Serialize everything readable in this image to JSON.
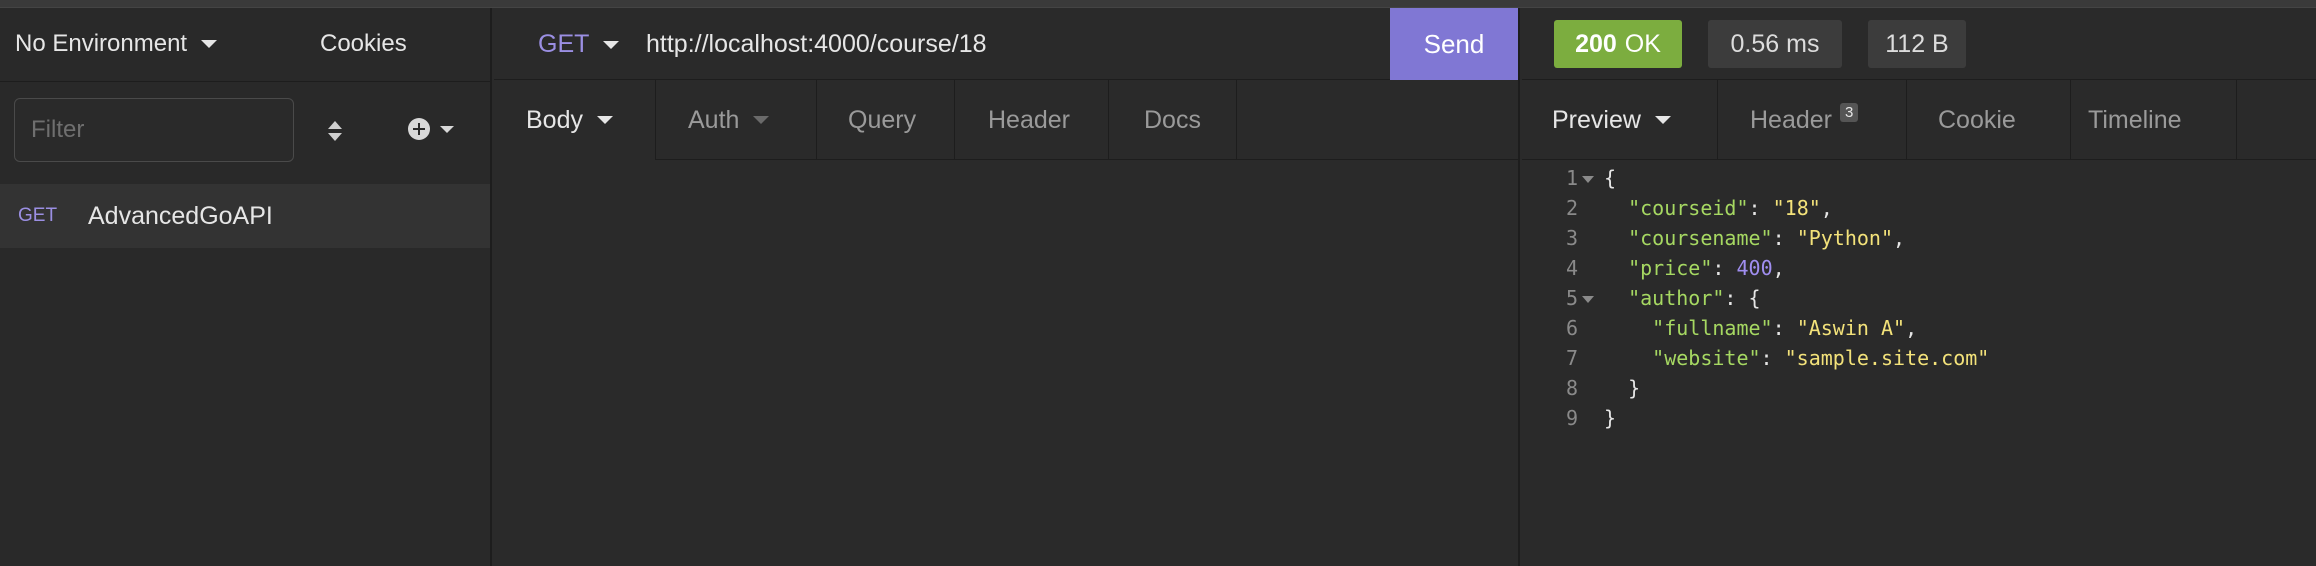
{
  "sidebar": {
    "environment": "No Environment",
    "cookies_label": "Cookies",
    "filter_placeholder": "Filter",
    "requests": [
      {
        "method": "GET",
        "name": "AdvancedGoAPI"
      }
    ]
  },
  "request": {
    "method": "GET",
    "url": "http://localhost:4000/course/18",
    "send_label": "Send",
    "tabs": [
      "Body",
      "Auth",
      "Query",
      "Header",
      "Docs"
    ]
  },
  "response": {
    "status_code": "200",
    "status_text": "OK",
    "time": "0.56 ms",
    "size": "112 B",
    "tabs": [
      "Preview",
      "Header",
      "Cookie",
      "Timeline"
    ],
    "header_count": "3",
    "body_lines": [
      {
        "n": "1",
        "parts": [
          [
            "p",
            "{"
          ]
        ]
      },
      {
        "n": "2",
        "parts": [
          [
            "p",
            "  "
          ],
          [
            "k",
            "\"courseid\""
          ],
          [
            "p",
            ": "
          ],
          [
            "s",
            "\"18\""
          ],
          [
            "p",
            ","
          ]
        ]
      },
      {
        "n": "3",
        "parts": [
          [
            "p",
            "  "
          ],
          [
            "k",
            "\"coursename\""
          ],
          [
            "p",
            ": "
          ],
          [
            "s",
            "\"Python\""
          ],
          [
            "p",
            ","
          ]
        ]
      },
      {
        "n": "4",
        "parts": [
          [
            "p",
            "  "
          ],
          [
            "k",
            "\"price\""
          ],
          [
            "p",
            ": "
          ],
          [
            "n",
            "400"
          ],
          [
            "p",
            ","
          ]
        ]
      },
      {
        "n": "5",
        "parts": [
          [
            "p",
            "  "
          ],
          [
            "k",
            "\"author\""
          ],
          [
            "p",
            ": {"
          ]
        ]
      },
      {
        "n": "6",
        "parts": [
          [
            "p",
            "    "
          ],
          [
            "k",
            "\"fullname\""
          ],
          [
            "p",
            ": "
          ],
          [
            "s",
            "\"Aswin A\""
          ],
          [
            "p",
            ","
          ]
        ]
      },
      {
        "n": "7",
        "parts": [
          [
            "p",
            "    "
          ],
          [
            "k",
            "\"website\""
          ],
          [
            "p",
            ": "
          ],
          [
            "s",
            "\"sample.site.com\""
          ]
        ]
      },
      {
        "n": "8",
        "parts": [
          [
            "p",
            "  }"
          ]
        ]
      },
      {
        "n": "9",
        "parts": [
          [
            "p",
            "}"
          ]
        ]
      }
    ]
  },
  "colors": {
    "accent": "#8077d4",
    "method_get": "#9b8fe3",
    "status_ok": "#7cad3f",
    "json_key": "#a6d862",
    "json_string": "#f3e27a",
    "json_number": "#a08ef0"
  }
}
